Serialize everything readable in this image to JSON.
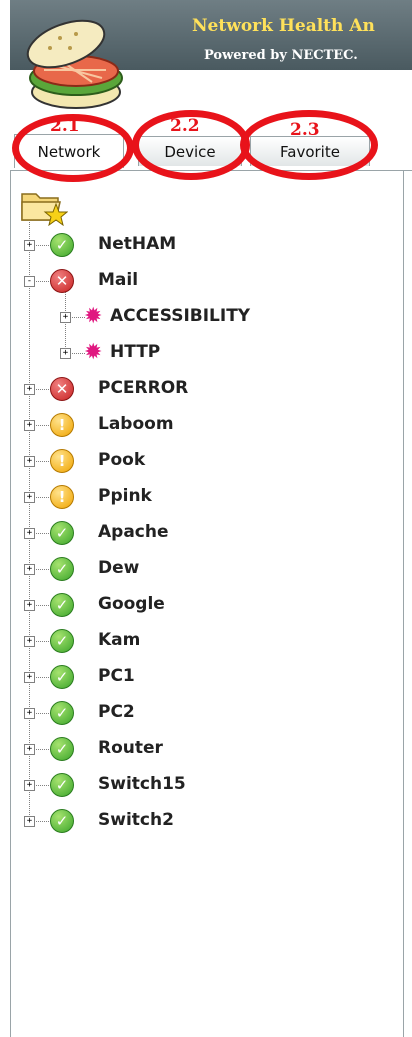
{
  "header": {
    "title": "Network Health An",
    "subtitle": "Powered by NECTEC."
  },
  "tabs": [
    {
      "label": "Network",
      "marker": "2.1",
      "active": true
    },
    {
      "label": "Device",
      "marker": "2.2",
      "active": false
    },
    {
      "label": "Favorite",
      "marker": "2.3",
      "active": false
    }
  ],
  "tree": {
    "root_icon": "favorite-folder-icon",
    "nodes": [
      {
        "label": "NetHAM",
        "status": "ok",
        "expander": "+"
      },
      {
        "label": "Mail",
        "status": "error",
        "expander": "-"
      },
      {
        "label": "ACCESSIBILITY",
        "status": "service",
        "expander": "+",
        "child": true
      },
      {
        "label": "HTTP",
        "status": "service",
        "expander": "+",
        "child": true
      },
      {
        "label": "PCERROR",
        "status": "error",
        "expander": "+"
      },
      {
        "label": "Laboom",
        "status": "warning",
        "expander": "+"
      },
      {
        "label": "Pook",
        "status": "warning",
        "expander": "+"
      },
      {
        "label": "Ppink",
        "status": "warning",
        "expander": "+"
      },
      {
        "label": "Apache",
        "status": "ok",
        "expander": "+"
      },
      {
        "label": "Dew",
        "status": "ok",
        "expander": "+"
      },
      {
        "label": "Google",
        "status": "ok",
        "expander": "+"
      },
      {
        "label": "Kam",
        "status": "ok",
        "expander": "+"
      },
      {
        "label": "PC1",
        "status": "ok",
        "expander": "+"
      },
      {
        "label": "PC2",
        "status": "ok",
        "expander": "+"
      },
      {
        "label": "Router",
        "status": "ok",
        "expander": "+"
      },
      {
        "label": "Switch15",
        "status": "ok",
        "expander": "+"
      },
      {
        "label": "Switch2",
        "status": "ok",
        "expander": "+"
      }
    ]
  },
  "colors": {
    "accent_red": "#e8131a",
    "title_yellow": "#ffe15a",
    "status_ok": "#3ba52a",
    "status_error": "#c82222",
    "status_warning": "#f0a400",
    "service_gear": "#e01880"
  }
}
